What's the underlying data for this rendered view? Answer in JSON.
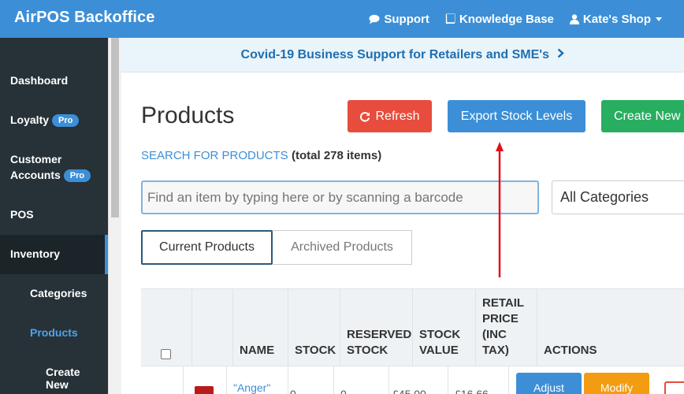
{
  "app": {
    "title": "AirPOS Backoffice"
  },
  "topnav": {
    "support": "Support",
    "knowledge_base": "Knowledge Base",
    "shop": "Kate's Shop"
  },
  "sidebar": {
    "items": [
      {
        "label": "Dashboard"
      },
      {
        "label": "Loyalty",
        "badge": "Pro"
      },
      {
        "label_line1": "Customer",
        "label_line2": "Accounts",
        "badge": "Pro"
      },
      {
        "label": "POS"
      },
      {
        "label": "Inventory"
      }
    ],
    "subitems": [
      {
        "label": "Categories"
      },
      {
        "label": "Products"
      },
      {
        "label_line1": "Create",
        "label_line2": "New"
      }
    ]
  },
  "banner": {
    "text": "Covid-19 Business Support for Retailers and SME's"
  },
  "main": {
    "title": "Products",
    "refresh_label": "Refresh",
    "export_label": "Export Stock Levels",
    "create_label": "Create New",
    "search_label": "SEARCH FOR PRODUCTS",
    "total_text": "(total 278 items)",
    "search_placeholder": "Find an item by typing here or by scanning a barcode",
    "category_select": "All Categories",
    "tabs": {
      "current": "Current Products",
      "archived": "Archived Products"
    }
  },
  "table": {
    "headers": {
      "name": "NAME",
      "stock": "STOCK",
      "reserved_1": "RESERVED",
      "reserved_2": "STOCK",
      "value_1": "STOCK",
      "value_2": "VALUE",
      "retail_1": "RETAIL",
      "retail_2": "PRICE",
      "retail_3": "(INC",
      "retail_4": "TAX)",
      "actions": "ACTIONS"
    },
    "rows": [
      {
        "name": "\"Anger\"",
        "stock": "0",
        "reserved": "0",
        "value": "£45.00",
        "price": "£16.66",
        "adjust": "Adjust",
        "modify": "Modify"
      }
    ]
  },
  "colors": {
    "topbar": "#3c8fd6",
    "sidebar": "#263238",
    "refresh": "#e74c3c",
    "export": "#3c8fd6",
    "create": "#27ae60",
    "modify": "#f39c12",
    "arrow": "#e0131a"
  }
}
